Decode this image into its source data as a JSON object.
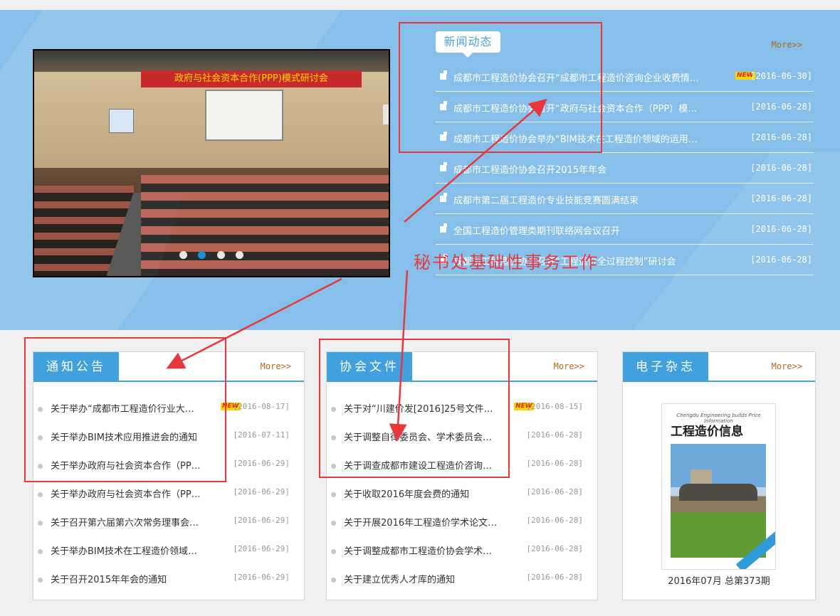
{
  "hero": {
    "slider": {
      "photo_banner": "政府与社会资本合作(PPP)模式研讨会",
      "dot_count": 4,
      "active_dot": 2
    },
    "news": {
      "title": "新闻动态",
      "more": "More>>",
      "items": [
        {
          "title": "成都市工程造价协会召开“成都市工程造价咨询企业收费情…",
          "date": "[2016-06-30]",
          "new": true
        },
        {
          "title": "成都市工程造价协会召开“政府与社会资本合作（PPP）模…",
          "date": "[2016-06-28]",
          "new": false
        },
        {
          "title": "成都市工程造价协会举办“BIM技术在工程造价领域的运用…",
          "date": "[2016-06-28]",
          "new": false
        },
        {
          "title": "成都市工程造价协会召开2015年年会",
          "date": "[2016-06-28]",
          "new": false
        },
        {
          "title": "成都市第二届工程造价专业技能竞赛圆满结束",
          "date": "[2016-06-28]",
          "new": false
        },
        {
          "title": "全国工程造价管理类期刊联络网会议召开",
          "date": "[2016-06-28]",
          "new": false
        },
        {
          "title": "成都市工程造价协会召开“工程造价全过程控制”研讨会",
          "date": "[2016-06-28]",
          "new": false
        }
      ]
    }
  },
  "new_badge": "NEW",
  "notices": {
    "title": "通知公告",
    "more": "More>>",
    "items": [
      {
        "title": "关于举办“成都市工程造价行业大…",
        "date": "[2016-08-17]",
        "new": true
      },
      {
        "title": "关于举办BIM技术应用推进会的通知",
        "date": "[2016-07-11]",
        "new": false
      },
      {
        "title": "关于举办政府与社会资本合作（PP…",
        "date": "[2016-06-29]",
        "new": false
      },
      {
        "title": "关于举办政府与社会资本合作（PP…",
        "date": "[2016-06-29]",
        "new": false
      },
      {
        "title": "关于召开第六届第六次常务理事会…",
        "date": "[2016-06-29]",
        "new": false
      },
      {
        "title": "关于举办BIM技术在工程造价领域…",
        "date": "[2016-06-29]",
        "new": false
      },
      {
        "title": "关于召开2015年年会的通知",
        "date": "[2016-06-29]",
        "new": false
      }
    ]
  },
  "documents": {
    "title": "协会文件",
    "more": "More>>",
    "items": [
      {
        "title": "关于对“川建价发[2016]25号文件…",
        "date": "[2016-08-15]",
        "new": true
      },
      {
        "title": "关于调整自律委员会、学术委员会…",
        "date": "[2016-06-28]",
        "new": false
      },
      {
        "title": "关于调查成都市建设工程造价咨询…",
        "date": "[2016-06-28]",
        "new": false
      },
      {
        "title": "关于收取2016年度会费的通知",
        "date": "[2016-06-28]",
        "new": false
      },
      {
        "title": "关于开展2016年工程造价学术论文…",
        "date": "[2016-06-28]",
        "new": false
      },
      {
        "title": "关于调整成都市工程造价协会学术…",
        "date": "[2016-06-28]",
        "new": false
      },
      {
        "title": "关于建立优秀人才库的通知",
        "date": "[2016-06-28]",
        "new": false
      }
    ]
  },
  "magazine": {
    "title": "电子杂志",
    "more": "More>>",
    "cover_en": "Chengdu Engineering builds Price Information",
    "cover_cn": "工程造价信息",
    "caption": "2016年07月  总第373期"
  },
  "annotation": {
    "label": "秘书处基础性事务工作",
    "color": "#e8383d"
  },
  "colors": {
    "hero_bg": "#86bfe9",
    "tab_blue": "#41a0de",
    "more_brown": "#b06a1d",
    "annotation_red": "#e8383d"
  }
}
